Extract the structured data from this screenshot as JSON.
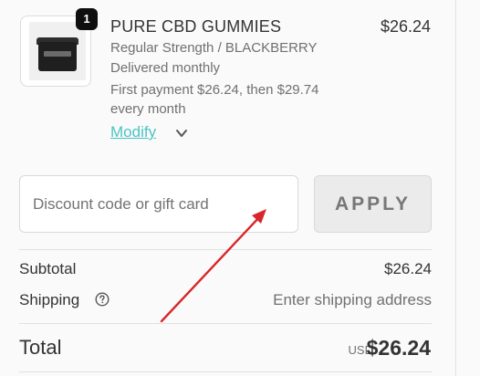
{
  "product": {
    "quantity": "1",
    "title": "PURE CBD GUMMIES",
    "price": "$26.24",
    "variant": "Regular Strength / BLACKBERRY",
    "frequency": "Delivered monthly",
    "payment_line1": "First payment $26.24, then $29.74",
    "payment_line2": "every month",
    "modify_label": "Modify",
    "image_icon": "product-jar-image"
  },
  "discount": {
    "placeholder": "Discount code or gift card",
    "value": "",
    "apply_label": "APPLY"
  },
  "summary": {
    "subtotal_label": "Subtotal",
    "subtotal_value": "$26.24",
    "shipping_label": "Shipping",
    "shipping_value": "Enter shipping address",
    "total_label": "Total",
    "total_currency": "USD",
    "total_value": "$26.24"
  },
  "colors": {
    "accent": "#4cc3c5",
    "annotation_arrow": "#d9262b",
    "badge": "#0f0f0f"
  }
}
